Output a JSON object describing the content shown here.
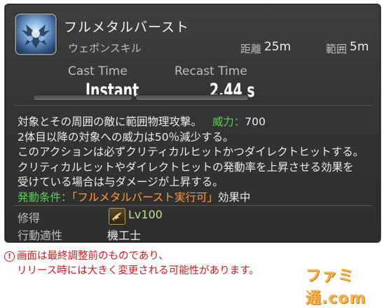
{
  "action": {
    "name": "フルメタルバースト",
    "type": "ウェポンスキル",
    "icon": "mechanical-machine-icon"
  },
  "range": {
    "distance_label": "距離",
    "distance_value": "25m",
    "radius_label": "範囲",
    "radius_value": "5m"
  },
  "timing": {
    "cast_label": "Cast Time",
    "cast_value": "Instant",
    "recast_label": "Recast Time",
    "recast_value": "2.44 s"
  },
  "description": {
    "line1": "対象とその周囲の敵に範囲物理攻撃。",
    "potency_label": "威力：",
    "potency_value": "700",
    "line2": "2体目以降の対象への威力は50％減少する。",
    "line3": "このアクションは必ずクリティカルヒットかつダイレクトヒットする。",
    "line4": "クリティカルヒットやダイレクトヒットの発動率を上昇させる効果を",
    "line5": "受けている場合は与ダメージが上昇する。",
    "condition_label": "発動条件：",
    "condition_value": "「フルメタルバースト実行可」",
    "condition_suffix": "効果中"
  },
  "meta": {
    "acquired_label": "修得",
    "acquired_level": "Lv100",
    "acquired_job_icon": "machinist-job-icon",
    "affinity_label": "行動適性",
    "affinity_value": "機工士"
  },
  "disclaimer": {
    "icon": "exclamation-circle-icon",
    "line1": "画面は最終調整前のものであり、",
    "line2": "リリース時には大きく変更される可能性があります。"
  },
  "watermark": "ファミ通.com",
  "colors": {
    "background": "#353535",
    "green": "#55d155",
    "orange": "#ff9a2e",
    "level": "#b7e97a",
    "disclaimer": "#d21a1a",
    "watermark": "#f7b24a"
  }
}
